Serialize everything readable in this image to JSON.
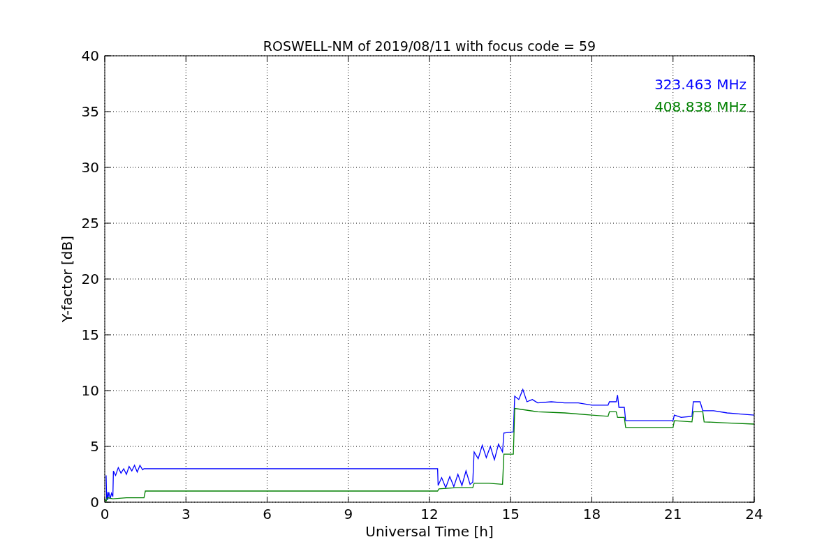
{
  "figure": {
    "chart_data": {
      "type": "line",
      "grid": true,
      "title": "ROSWELL-NM of 2019/08/11 with focus code = 59",
      "xlabel": "Universal Time [h]",
      "ylabel": "Y-factor [dB]",
      "xlim": [
        0,
        24
      ],
      "ylim": [
        0,
        40
      ],
      "xticks": [
        0,
        3,
        6,
        9,
        12,
        15,
        18,
        21,
        24
      ],
      "yticks": [
        0,
        5,
        10,
        15,
        20,
        25,
        30,
        35,
        40
      ],
      "series": [
        {
          "name": "323.463 MHz",
          "color": "#0000ff",
          "x": [
            0.05,
            0.07,
            0.09,
            0.11,
            0.15,
            0.2,
            0.25,
            0.3,
            0.32,
            0.4,
            0.5,
            0.6,
            0.7,
            0.8,
            0.9,
            1.0,
            1.1,
            1.2,
            1.3,
            1.4,
            1.45,
            1.5,
            12.3,
            12.32,
            12.45,
            12.6,
            12.75,
            12.9,
            13.05,
            13.2,
            13.35,
            13.5,
            13.6,
            13.65,
            13.8,
            13.95,
            14.1,
            14.25,
            14.4,
            14.55,
            14.7,
            14.75,
            15.1,
            15.15,
            15.3,
            15.45,
            15.6,
            15.8,
            16.0,
            16.5,
            17.0,
            17.5,
            18.0,
            18.6,
            18.65,
            18.9,
            18.95,
            19.0,
            19.2,
            19.25,
            21.0,
            21.05,
            21.3,
            21.7,
            21.75,
            22.0,
            22.1,
            22.5,
            23.0,
            23.5,
            24.0
          ],
          "values": [
            2.4,
            0.3,
            0.9,
            0.2,
            0.9,
            0.3,
            0.8,
            0.5,
            2.8,
            2.4,
            3.1,
            2.6,
            3.0,
            2.5,
            3.2,
            2.8,
            3.3,
            2.7,
            3.3,
            2.9,
            3.0,
            3.0,
            3.0,
            1.5,
            2.2,
            1.3,
            2.3,
            1.4,
            2.5,
            1.5,
            2.8,
            1.6,
            1.8,
            4.5,
            3.9,
            5.1,
            4.0,
            5.0,
            3.8,
            5.2,
            4.5,
            6.2,
            6.3,
            9.5,
            9.2,
            10.1,
            9.0,
            9.2,
            8.9,
            9.0,
            8.9,
            8.9,
            8.7,
            8.7,
            9.0,
            9.0,
            9.6,
            8.5,
            8.5,
            7.3,
            7.3,
            7.8,
            7.6,
            7.7,
            9.0,
            9.0,
            8.2,
            8.2,
            8.0,
            7.9,
            7.8
          ]
        },
        {
          "name": "408.838 MHz",
          "color": "#008000",
          "x": [
            0,
            0.05,
            0.1,
            0.3,
            0.8,
            1.45,
            1.5,
            12.3,
            12.35,
            13.0,
            13.6,
            13.65,
            14.2,
            14.7,
            14.75,
            15.1,
            15.15,
            16.0,
            17.0,
            18.0,
            18.6,
            18.65,
            18.9,
            18.95,
            19.2,
            19.25,
            21.0,
            21.05,
            21.7,
            21.75,
            22.1,
            22.15,
            23.0,
            24.0
          ],
          "values": [
            0.3,
            0.1,
            0.4,
            0.3,
            0.4,
            0.4,
            1.0,
            1.0,
            1.2,
            1.3,
            1.3,
            1.7,
            1.7,
            1.6,
            4.3,
            4.3,
            8.4,
            8.1,
            8.0,
            7.8,
            7.7,
            8.1,
            8.1,
            7.6,
            7.6,
            6.7,
            6.7,
            7.3,
            7.2,
            8.1,
            8.1,
            7.2,
            7.1,
            7.0
          ]
        }
      ]
    }
  }
}
